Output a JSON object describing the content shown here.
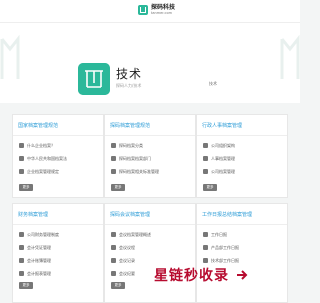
{
  "header": {
    "logo_name": "探码科技",
    "logo_domain": "tanmer.com"
  },
  "hero": {
    "title": "技术",
    "subtitle": "探码人力/技术",
    "tag": "技术"
  },
  "cards": [
    {
      "title": "国家档案管理规范",
      "items": [
        "什么企业档案？",
        "中华人民共和国档案法",
        "企业档案管理规定"
      ],
      "more": "更多"
    },
    {
      "title": "探码档案管理规范",
      "items": [
        "探码档案分类",
        "探码档案档案部门",
        "探码档案相关标准管理"
      ],
      "more": "更多"
    },
    {
      "title": "行政人事档案管理",
      "items": [
        "公司组织架构",
        "人事档案管理",
        "公司档案管理"
      ],
      "more": "更多"
    },
    {
      "title": "财务档案管理",
      "items": [
        "公司财务管理制度",
        "会计凭证管理",
        "会计账簿管理",
        "会计报表管理"
      ],
      "more": "更多"
    },
    {
      "title": "探码会议档案管理",
      "items": [
        "会议档案管理概述",
        "会议议程",
        "会议记录",
        "会议纪要"
      ],
      "more": "更多"
    },
    {
      "title": "工作日报总结档案管理",
      "items": [
        "工作日报",
        "产品部工作日报",
        "技术部工作日报"
      ],
      "more": "更多"
    }
  ],
  "watermark": {
    "text": "星链秒收录"
  },
  "colors": {
    "brand": "#2bb89a",
    "link": "#2a9bd6",
    "watermark": "#b70b2f"
  }
}
